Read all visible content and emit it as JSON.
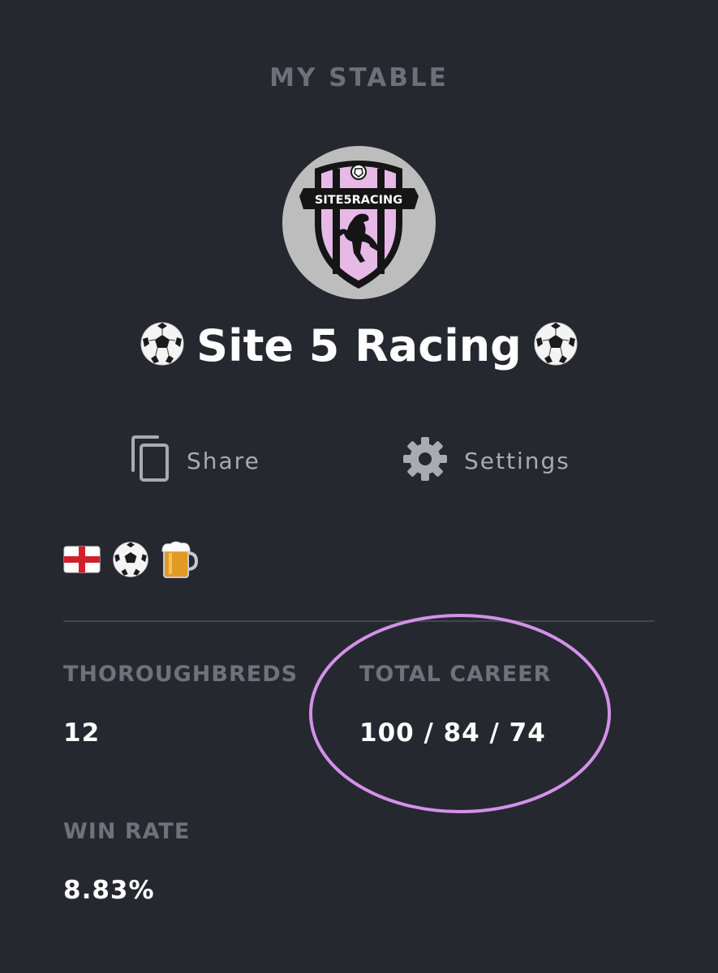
{
  "header": {
    "title": "MY STABLE"
  },
  "stable": {
    "name": "Site 5 Racing",
    "logo_text": "SITE5RACING",
    "title_icons": [
      "soccer-ball-icon",
      "soccer-ball-icon"
    ]
  },
  "actions": {
    "share_label": "Share",
    "settings_label": "Settings"
  },
  "badges": [
    "england-flag-icon",
    "soccer-ball-icon",
    "beer-mug-icon"
  ],
  "stats": {
    "thoroughbreds_label": "THOROUGHBREDS",
    "thoroughbreds_value": "12",
    "total_career_label": "TOTAL CAREER",
    "total_career_value": "100 / 84 / 74",
    "win_rate_label": "WIN RATE",
    "win_rate_value": "8.83%"
  },
  "colors": {
    "background": "#262830",
    "label": "#6f727b",
    "logo_pink": "#e6b9e6",
    "highlight_circle": "#d391e8"
  }
}
